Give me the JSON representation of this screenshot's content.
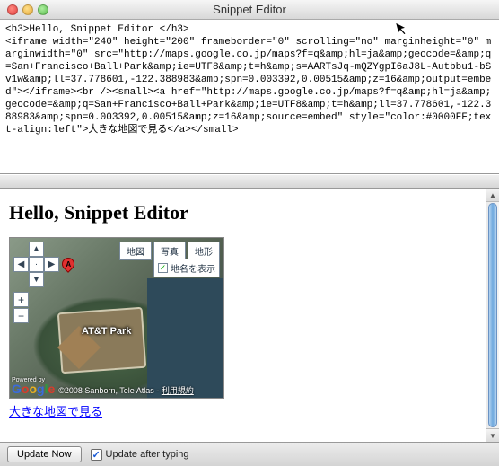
{
  "window": {
    "title": "Snippet Editor"
  },
  "editor": {
    "source": "<h3>Hello, Snippet Editor </h3>\n<iframe width=\"240\" height=\"200\" frameborder=\"0\" scrolling=\"no\" marginheight=\"0\" marginwidth=\"0\" src=\"http://maps.google.co.jp/maps?f=q&amp;hl=ja&amp;geocode=&amp;q=San+Francisco+Ball+Park&amp;ie=UTF8&amp;t=h&amp;s=AARTsJq-mQZYgpI6aJ8L-Autbbu1-bSv1w&amp;ll=37.778601,-122.388983&amp;spn=0.003392,0.00515&amp;z=16&amp;output=embed\"></iframe><br /><small><a href=\"http://maps.google.co.jp/maps?f=q&amp;hl=ja&amp;geocode=&amp;q=San+Francisco+Ball+Park&amp;ie=UTF8&amp;t=h&amp;ll=37.778601,-122.388983&amp;spn=0.003392,0.00515&amp;z=16&amp;source=embed\" style=\"color:#0000FF;text-align:left\">大きな地図で見る</a></small>"
  },
  "preview": {
    "heading": "Hello, Snippet Editor",
    "map": {
      "pin_letter": "A",
      "place_label": "AT&T Park",
      "tabs": {
        "map": "地図",
        "photo": "写真",
        "terrain": "地形"
      },
      "show_labels": "地名を表示",
      "show_labels_checked": true,
      "powered": "Powered by",
      "attribution": "©2008 Sanborn, Tele Atlas - ",
      "terms": "利用規約"
    },
    "large_map_link": "大きな地図で見る"
  },
  "bottombar": {
    "update_now": "Update Now",
    "update_after_typing": "Update after typing",
    "update_after_typing_checked": true
  }
}
